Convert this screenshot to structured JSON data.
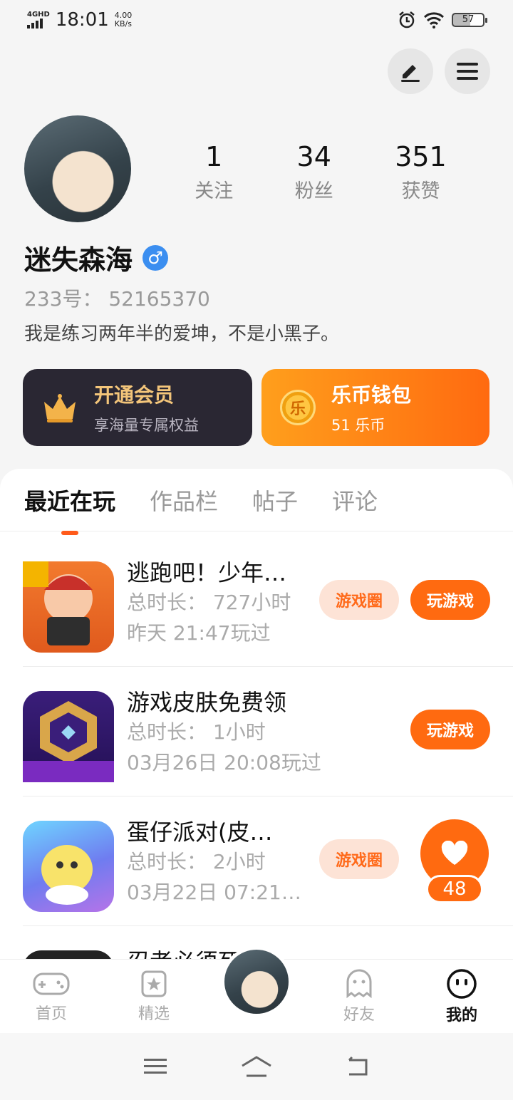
{
  "status": {
    "network": "4GHD",
    "time": "18:01",
    "speed_value": "4.00",
    "speed_unit": "KB/s",
    "battery": "57"
  },
  "profile": {
    "following_count": "1",
    "following_label": "关注",
    "fans_count": "34",
    "fans_label": "粉丝",
    "likes_count": "351",
    "likes_label": "获赞",
    "username": "迷失森海",
    "gender_symbol": "♂",
    "uid": "233号：  52165370",
    "bio": "我是练习两年半的爱坤，不是小黑子。"
  },
  "cards": {
    "vip_title": "开通会员",
    "vip_sub": "享海量专属权益",
    "wallet_coin": "乐",
    "wallet_title": "乐币钱包",
    "wallet_sub": "51 乐币"
  },
  "tabs": [
    "最近在玩",
    "作品栏",
    "帖子",
    "评论"
  ],
  "games": [
    {
      "name": "逃跑吧！少年…",
      "duration": "总时长：  727小时",
      "last_played": "昨天 21:47玩过",
      "circle_label": "游戏圈",
      "play_label": "玩游戏"
    },
    {
      "name": "游戏皮肤免费领",
      "duration": "总时长：  1小时",
      "last_played": "03月26日 20:08玩过",
      "play_label": "玩游戏"
    },
    {
      "name": "蛋仔派对(皮…",
      "duration": "总时长：  2小时",
      "last_played": "03月22日 07:21…",
      "circle_label": "游戏圈"
    },
    {
      "name": "忍者必须死"
    }
  ],
  "float_like": {
    "count": "48"
  },
  "bottom_nav": {
    "home": "首页",
    "featured": "精选",
    "friends": "好友",
    "mine": "我的"
  },
  "colors": {
    "accent": "#ff6a10",
    "vip_bg": "#2a2733",
    "vip_gold": "#f3c57a",
    "gender_blue": "#3b8ef0"
  }
}
